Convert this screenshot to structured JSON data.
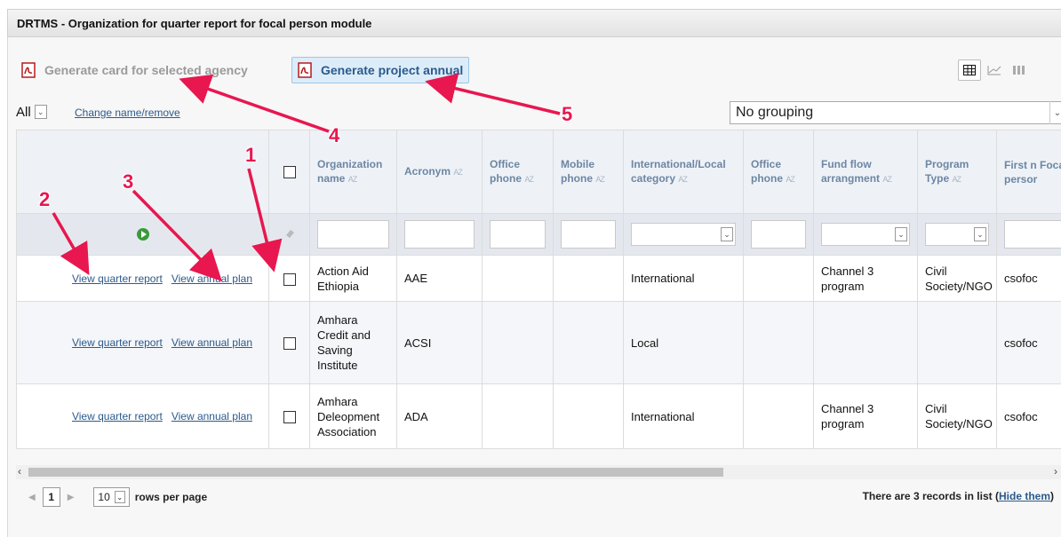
{
  "window": {
    "title": "DRTMS - Organization for quarter report for focal person module"
  },
  "toolbar": {
    "generate_card_label": "Generate card for selected agency",
    "generate_project_label": "Generate project annual",
    "views": [
      "grid-view-icon",
      "chart-view-icon",
      "columns-view-icon"
    ]
  },
  "filterbar": {
    "select_value": "All",
    "change_link": "Change name/remove",
    "grouping_value": "No grouping"
  },
  "table": {
    "columns": [
      {
        "label": "Organization name",
        "sortable": true
      },
      {
        "label": "Acronym",
        "sortable": true
      },
      {
        "label": "Office phone",
        "sortable": true
      },
      {
        "label": "Mobile phone",
        "sortable": true
      },
      {
        "label": "International/Local category",
        "sortable": true
      },
      {
        "label": "Office phone",
        "sortable": true
      },
      {
        "label": "Fund flow arrangment",
        "sortable": true
      },
      {
        "label": "Program Type",
        "sortable": true
      },
      {
        "label": "First n Focal persor",
        "sortable": false
      }
    ],
    "sort_glyph": "AZ",
    "row_actions": {
      "quarter": "View quarter report",
      "annual": "View annual plan"
    },
    "rows": [
      {
        "name": "Action Aid Ethiopia",
        "acronym": "AAE",
        "office_phone": "",
        "mobile_phone": "",
        "category": "International",
        "office_phone2": "",
        "fund_flow": "Channel 3 program",
        "program_type": "Civil Society/NGO",
        "first": "csofoc"
      },
      {
        "name": "Amhara Credit and Saving Institute",
        "acronym": "ACSI",
        "office_phone": "",
        "mobile_phone": "",
        "category": "Local",
        "office_phone2": "",
        "fund_flow": "",
        "program_type": "",
        "first": "csofoc"
      },
      {
        "name": "Amhara Deleopment Association",
        "acronym": "ADA",
        "office_phone": "",
        "mobile_phone": "",
        "category": "International",
        "office_phone2": "",
        "fund_flow": "Channel 3 program",
        "program_type": "Civil Society/NGO",
        "first": "csofoc"
      }
    ]
  },
  "pager": {
    "current_page": "1",
    "rows_per_page": "10",
    "rows_per_page_label": "rows per page",
    "records_text": "There are 3 records in list (",
    "hide_link": "Hide them",
    "records_close": ")"
  },
  "annotations": [
    "1",
    "2",
    "3",
    "4",
    "5"
  ],
  "colors": {
    "accent": "#2c5a8c",
    "annotation": "#e8174f",
    "header_text": "#6d86a3"
  }
}
